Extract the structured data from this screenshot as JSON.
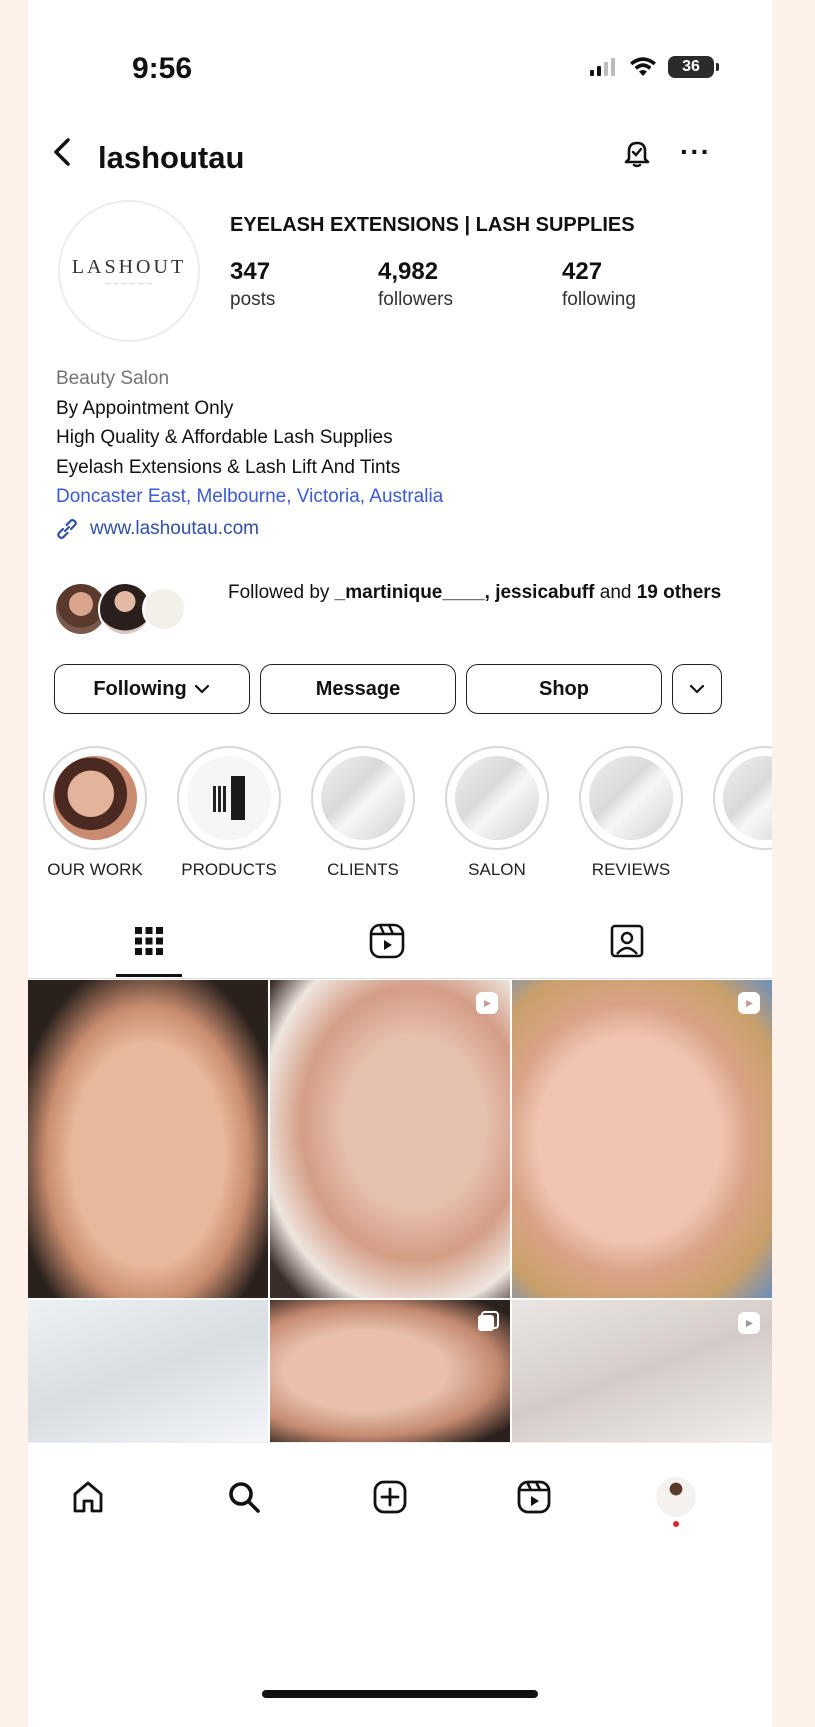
{
  "status_bar": {
    "time": "9:56",
    "battery": "36"
  },
  "header": {
    "username": "lashoutau"
  },
  "profile": {
    "avatar_logo": "LASHOUT",
    "display_name": "EYELASH EXTENSIONS | LASH SUPPLIES",
    "stats": [
      {
        "value": "347",
        "label": "posts"
      },
      {
        "value": "4,982",
        "label": "followers"
      },
      {
        "value": "427",
        "label": "following"
      }
    ],
    "category": "Beauty Salon",
    "bio_lines": [
      "By Appointment Only",
      "High Quality & Affordable Lash Supplies",
      "Eyelash Extensions & Lash Lift And Tints"
    ],
    "location": "Doncaster East, Melbourne, Victoria, Australia",
    "website": "www.lashoutau.com"
  },
  "followed_by": {
    "prefix": "Followed by ",
    "user1": "_martinique____",
    "sep": ", ",
    "user2": "jessicabuff",
    "and_text": " and ",
    "count": "19",
    "suffix": "others"
  },
  "actions": {
    "following": "Following",
    "message": "Message",
    "shop": "Shop"
  },
  "highlights": [
    {
      "label": "OUR WORK"
    },
    {
      "label": "PRODUCTS"
    },
    {
      "label": "CLIENTS"
    },
    {
      "label": "SALON"
    },
    {
      "label": "REVIEWS"
    }
  ],
  "colors": {
    "accent_link": "#3b5ad6",
    "text": "#111111",
    "muted": "#737373",
    "border": "#222222"
  }
}
